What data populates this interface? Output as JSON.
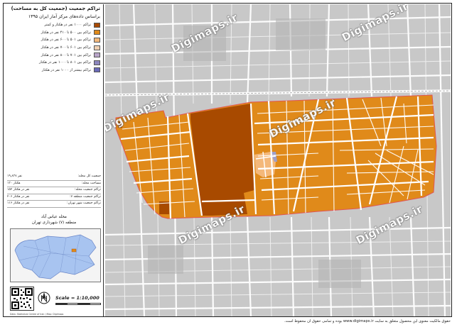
{
  "legend": {
    "title_line1": "تراکم جمعیت (جمعیت کل به مساحت)",
    "title_line2": "براساس داده‌های مرکز آمار ایران ۱۳۹۵",
    "classes": [
      {
        "label": "تراکم ۱۰۰۰ نفر در هکتار و کمتر",
        "color": "#a84a00"
      },
      {
        "label": "تراکم بین ۵۰۰ تا ۴۱۰ نفر در هکتار",
        "color": "#e08a1a"
      },
      {
        "label": "تراکم بین ۵۰۱ تا ۶۰۰ نفر در هکتار",
        "color": "#f4b87a"
      },
      {
        "label": "تراکم بین ۶۰۱ تا ۷۰۰ نفر در هکتار",
        "color": "#efd0b2"
      },
      {
        "label": "تراکم بین ۷۰۱ تا ۸۰۰ نفر در هکتار",
        "color": "#b8a4c8"
      },
      {
        "label": "تراکم بین ۸۰۱ تا ۱۰۰۰ نفر در هکتار",
        "color": "#8c86bd"
      },
      {
        "label": "تراکم بیشتر از ۱۰۰۰ نفر در هکتار",
        "color": "#6a6ab8"
      }
    ]
  },
  "stats": [
    {
      "label": "جمعیت کل محله:",
      "value": "۱۹,۸۳۷ نفر"
    },
    {
      "label": "مساحت محله:",
      "value": "۱۳۰ هکتار"
    },
    {
      "label": "تراکم جمعیت محله:",
      "value": "۱۵۲ نفر در هکتار"
    },
    {
      "label": "تراکم جمعیت منطقه ۷:",
      "value": "۲۰۶ نفر در هکتار"
    },
    {
      "label": "تراکم جمعیت شهر تهران:",
      "value": "۱۱۶ نفر در هکتار"
    }
  ],
  "region": {
    "line1": "محله عباس آباد",
    "line2": "منطقه (۷) شهرداری تهران"
  },
  "scale": "Scale = 1:10,000",
  "credit": "Data: Statistical Centre of Iran | Map: Digimaps",
  "footer": "حقوق مالکیت معنوی این محصول متعلق به سایت www.digimaps.ir بوده و تمامی حقوق آن محفوظ است.",
  "watermark": "Digimaps.ir",
  "colors": {
    "class1_darkest": "#a84a00",
    "class2": "#e08a1a",
    "class3": "#f4b87a",
    "street": "#ffffff",
    "background": "#c8c8c8",
    "boundary": "#e05555"
  }
}
